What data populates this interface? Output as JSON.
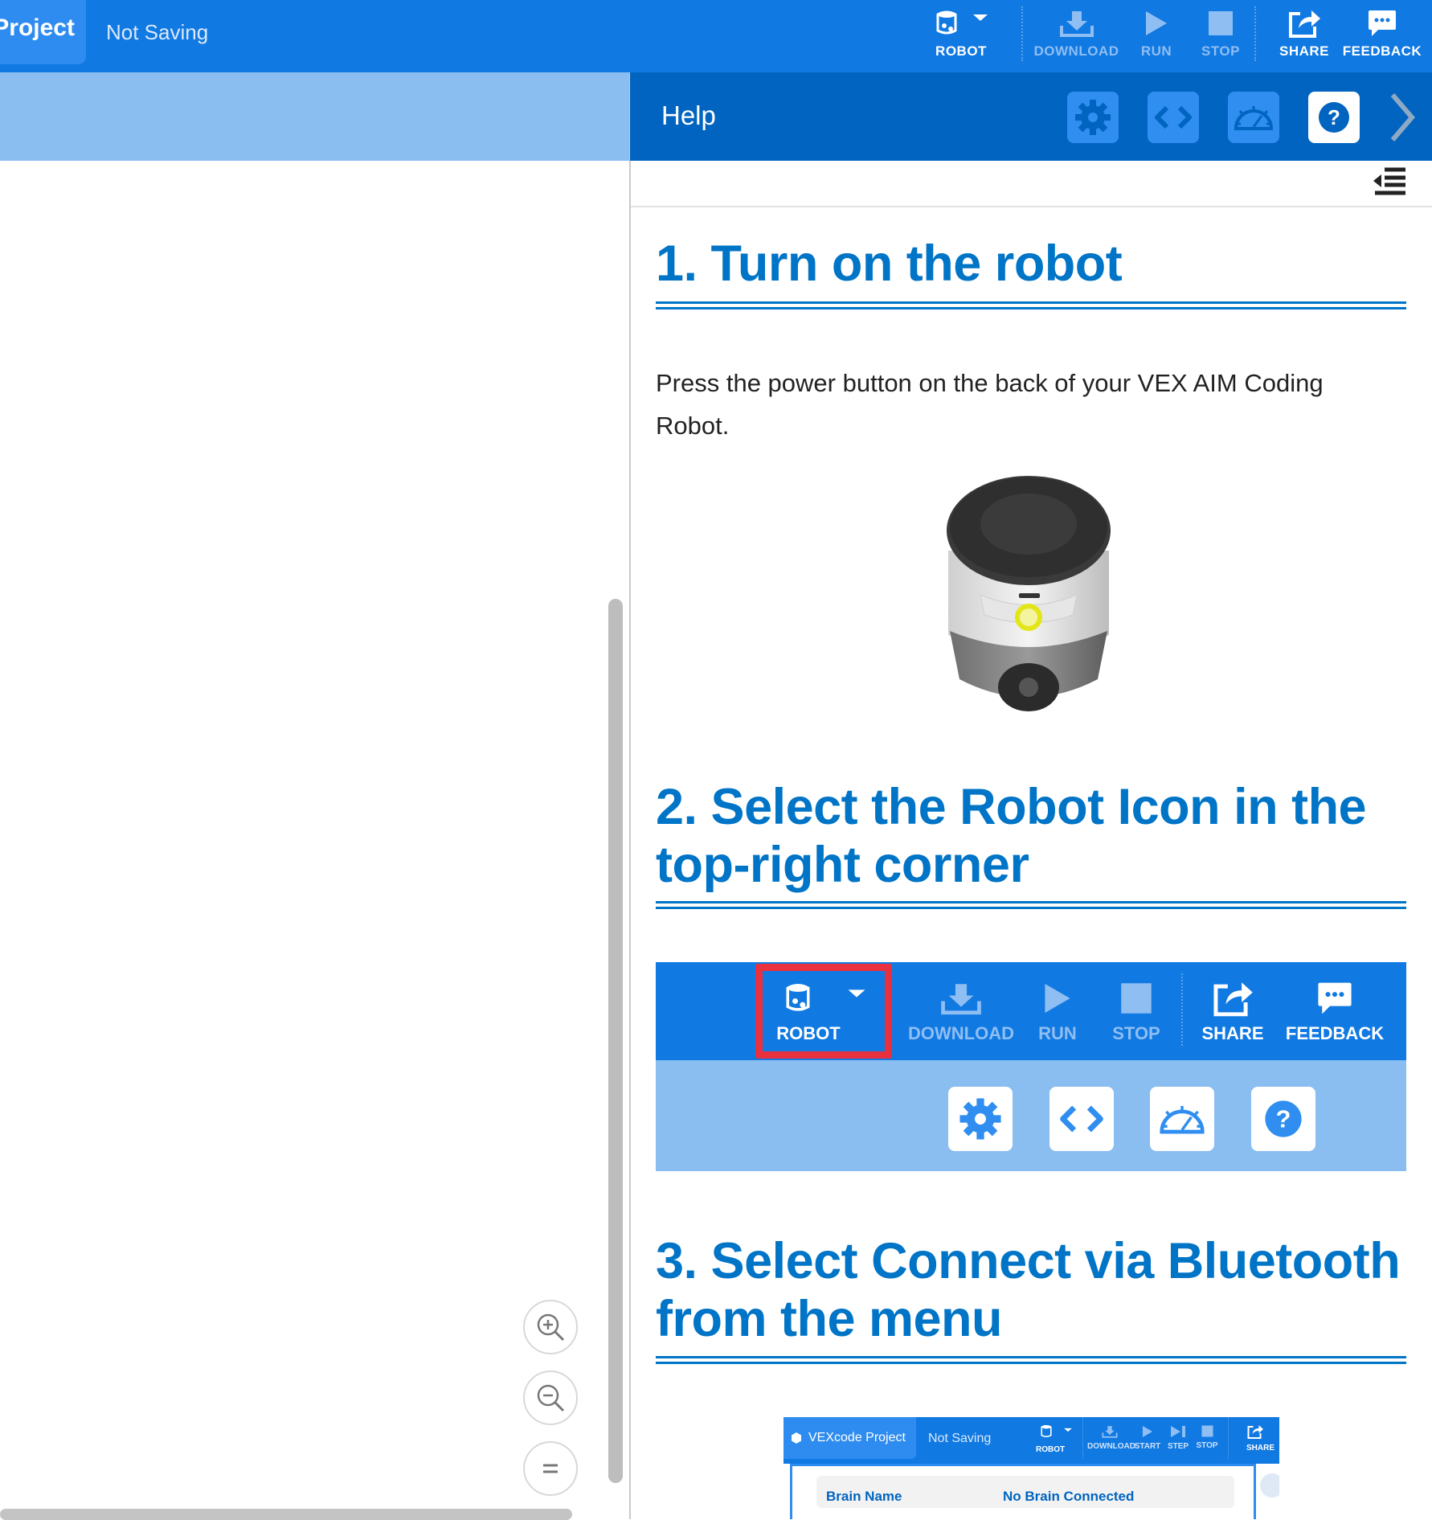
{
  "header": {
    "project_label": "Project",
    "save_status": "Not Saving",
    "buttons": {
      "robot": "ROBOT",
      "download": "DOWNLOAD",
      "run": "RUN",
      "stop": "STOP",
      "share": "SHARE",
      "feedback": "FEEDBACK"
    }
  },
  "help_panel": {
    "title": "Help",
    "tool_icons": [
      "gear-icon",
      "code-view-icon",
      "dashboard-icon",
      "help-icon"
    ],
    "steps": [
      {
        "heading": "1. Turn on the robot"
      },
      {
        "heading": "2. Select the Robot Icon in the top-right corner"
      },
      {
        "heading": "3. Select Connect via Bluetooth from the menu"
      }
    ],
    "step1_text": "Press the power button on the back of your VEX AIM Coding Robot."
  },
  "step2_screenshot": {
    "buttons": {
      "robot": "ROBOT",
      "download": "DOWNLOAD",
      "run": "RUN",
      "stop": "STOP",
      "share": "SHARE",
      "feedback": "FEEDBACK"
    },
    "highlight_color": "#e8303f"
  },
  "step3_screenshot": {
    "project_name": "VEXcode Project",
    "save_status": "Not Saving",
    "buttons": {
      "robot": "ROBOT",
      "download": "DOWNLOAD",
      "start": "START",
      "step": "STEP",
      "stop": "STOP",
      "share": "SHARE"
    },
    "brain_name_label": "Brain Name",
    "brain_status": "No Brain Connected"
  },
  "colors": {
    "header_blue": "#1079e2",
    "panel_header": "#0064c0",
    "heading_blue": "#0074c6",
    "workspace_band": "#8abdf0"
  }
}
